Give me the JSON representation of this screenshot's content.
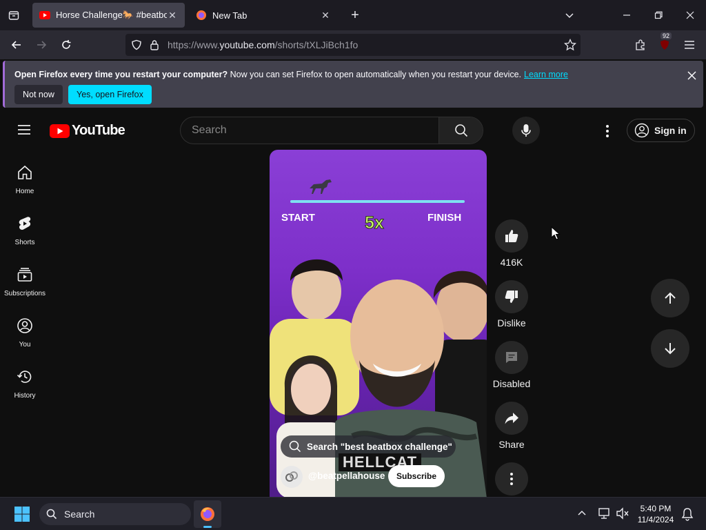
{
  "browser": {
    "tabs": [
      {
        "title": "Horse Challenge🐎 #beatbox #",
        "active": true
      },
      {
        "title": "New Tab",
        "active": false
      }
    ],
    "url_prefix": "https://www.",
    "url_domain": "youtube.com",
    "url_path": "/shorts/tXLJiBch1fo",
    "extensions_badge": "92"
  },
  "notification": {
    "bold_text": "Open Firefox every time you restart your computer?",
    "text": " Now you can set Firefox to open automatically when you restart your device.",
    "link": "Learn more",
    "not_now": "Not now",
    "yes": "Yes, open Firefox"
  },
  "youtube": {
    "logo_text": "YouTube",
    "search_placeholder": "Search",
    "sign_in": "Sign in",
    "sidebar": [
      {
        "label": "Home",
        "icon": "home-icon"
      },
      {
        "label": "Shorts",
        "icon": "shorts-icon"
      },
      {
        "label": "Subscriptions",
        "icon": "subscriptions-icon"
      },
      {
        "label": "You",
        "icon": "you-icon"
      },
      {
        "label": "History",
        "icon": "history-icon"
      }
    ],
    "video": {
      "start_label": "START",
      "finish_label": "FINISH",
      "speed_label": "5x",
      "search_pill": "Search \"best beatbox challenge\"",
      "overlay_caption": "HELLCAT",
      "channel": "@beatpellahouse",
      "subscribe": "Subscribe"
    },
    "actions": {
      "likes": "416K",
      "dislike": "Dislike",
      "comments": "Disabled",
      "share": "Share"
    }
  },
  "taskbar": {
    "search_label": "Search",
    "time": "5:40 PM",
    "date": "11/4/2024"
  },
  "colors": {
    "youtube_red": "#ff0000",
    "firefox_accent": "#00ddff",
    "video_purple": "#8a3fd6"
  }
}
